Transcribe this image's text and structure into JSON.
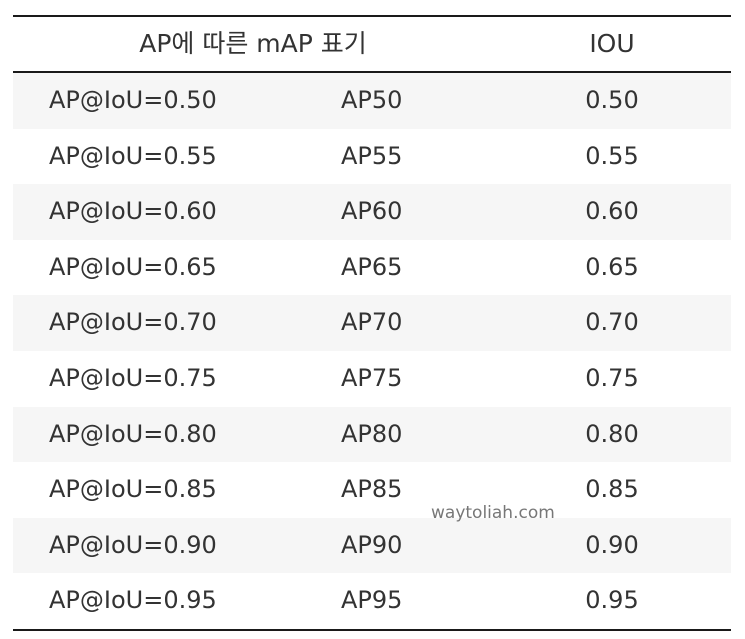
{
  "table": {
    "headers": [
      "AP에 따른 mAP 표기",
      "IOU"
    ],
    "rows": [
      [
        "AP@IoU=0.50",
        "AP50",
        "0.50"
      ],
      [
        "AP@IoU=0.55",
        "AP55",
        "0.55"
      ],
      [
        "AP@IoU=0.60",
        "AP60",
        "0.60"
      ],
      [
        "AP@IoU=0.65",
        "AP65",
        "0.65"
      ],
      [
        "AP@IoU=0.70",
        "AP70",
        "0.70"
      ],
      [
        "AP@IoU=0.75",
        "AP75",
        "0.75"
      ],
      [
        "AP@IoU=0.80",
        "AP80",
        "0.80"
      ],
      [
        "AP@IoU=0.85",
        "AP85",
        "0.85"
      ],
      [
        "AP@IoU=0.90",
        "AP90",
        "0.90"
      ],
      [
        "AP@IoU=0.95",
        "AP95",
        "0.95"
      ]
    ]
  },
  "watermark": "waytoliah.com",
  "colors": {
    "text": "#333333",
    "rule": "#1a1a1a",
    "row_shade": "#f6f6f6"
  }
}
